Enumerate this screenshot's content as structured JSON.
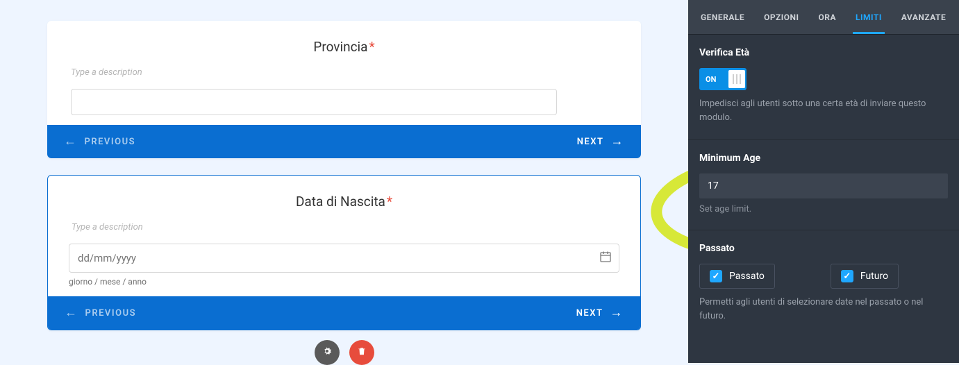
{
  "main": {
    "cards": [
      {
        "title": "Provincia",
        "desc_ph": "Type a description",
        "input_value": "",
        "prev_label": "PREVIOUS",
        "next_label": "NEXT"
      },
      {
        "title": "Data di Nascita",
        "desc_ph": "Type a description",
        "date_ph": "dd/mm/yyyy",
        "date_hint": "giorno / mese / anno",
        "prev_label": "PREVIOUS",
        "next_label": "NEXT"
      }
    ]
  },
  "sidebar": {
    "tabs": {
      "generale": "GENERALE",
      "opzioni": "OPZIONI",
      "ora": "ORA",
      "limiti": "LIMITI",
      "avanzate": "AVANZATE"
    },
    "age_title": "Verifica Età",
    "on_label": "ON",
    "age_help": "Impedisci agli utenti sotto una certa età di inviare questo modulo.",
    "min_age_title": "Minimum Age",
    "min_age_value": "17",
    "min_age_sub": "Set age limit.",
    "past_title": "Passato",
    "past_label": "Passato",
    "future_label": "Futuro",
    "past_help": "Permetti agli utenti di selezionare date nel passato o nel futuro."
  }
}
